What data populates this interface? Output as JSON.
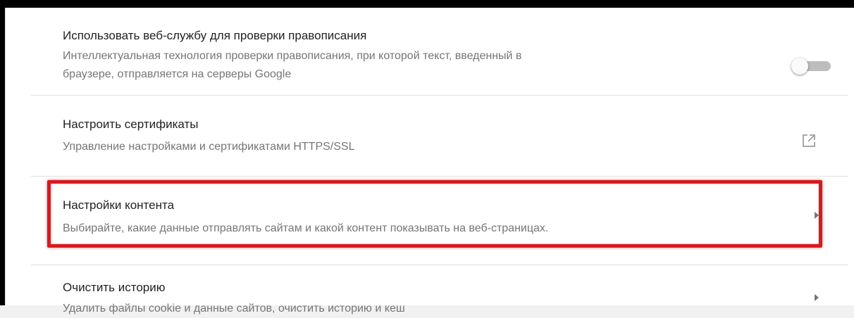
{
  "settings": {
    "rows": [
      {
        "title": "Использовать веб-службу для проверки правописания",
        "subtitle_line1": "Интеллектуальная технология проверки правописания, при которой текст, введенный в",
        "subtitle_line2": "браузере, отправляется на серверы Google",
        "control": "toggle",
        "toggle_state": "off"
      },
      {
        "title": "Настроить сертификаты",
        "subtitle": "Управление настройками и сертификатами HTTPS/SSL",
        "control": "external-link-icon"
      },
      {
        "title": "Настройки контента",
        "subtitle": "Выбирайте, какие данные отправлять сайтам и какой контент показывать на веб-страницах.",
        "control": "chevron-right-icon",
        "highlighted": true,
        "highlight_color": "#d8191e"
      },
      {
        "title": "Очистить историю",
        "subtitle": "Удалить файлы cookie и данные сайтов, очистить историю и кеш",
        "control": "chevron-right-icon"
      }
    ]
  }
}
